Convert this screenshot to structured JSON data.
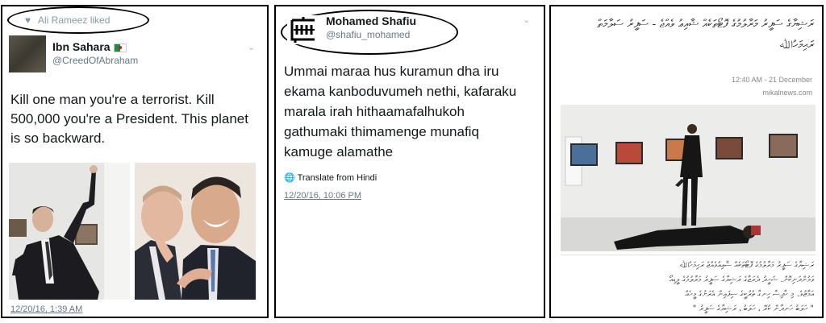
{
  "panel1": {
    "liked_by": "Ali Rameez liked",
    "author_name": "Ibn Sahara",
    "author_handle": "@CreedOfAbraham",
    "text": "Kill one man you're a terrorist. Kill 500,000 you're a President. This planet is so backward.",
    "timestamp": "12/20/16, 1:39 AM"
  },
  "panel2": {
    "author_name": "Mohamed Shafiu",
    "author_handle": "@shafiu_mohamed",
    "text": "Ummai maraa hus kuramun dha iru ekama kanboduvumeh nethi, kafaraku marala irah hithaamafalhukoh gathumaki thimamenge munafiq kamuge alamathe",
    "translate_label": "Translate from Hindi",
    "timestamp": "12/20/16, 10:06 PM"
  },
  "panel3": {
    "headline": "ރަޝިޔާގެ ސަފީރު މަރާލުމުގެ ފޮޓޯތަކެއް ޝާއިޢު ވެއްޖެ - ސަފީރު ސަލާމަތް",
    "headline_line2": "ރަޙިމަހުﷲ",
    "time": "12:40 AM - 21 December",
    "source": "mikalnews.com",
    "body": [
      "ރަޝިޔާގެ ސަފީރު މަރާލުމުގެ ފޮޓޯތަކެއް ޝާއިޢުވެއްޖެ ރަޙިމަހުﷲ",
      "ވަމުންދަނިކޮށް. ޝަހީދު ދެރަޖާގެ ރަޝިޔާގެ ސަފީރު މަރާލުމުގެ ވީޑިއޯ",
      "އަމާޒުވެ. މި ހާދިސާ ހިނގާ ތުރުކީގެ ސިފައިން އެރަށުގެ މީހެއް",
      "\" ހަލަބު ހަނދާން ކުރޭ ، ހަލަބު ، ރަޝިޔާގެ ސަފީރު \""
    ]
  },
  "colors": {
    "meta_gray": "#657786",
    "link_gray": "#8899a6",
    "annotation_oval": "#000000"
  },
  "icons": {
    "heart": "heart-icon",
    "chevron": "chevron-down-icon",
    "globe": "globe-icon",
    "flag": "algeria-flag-icon"
  }
}
